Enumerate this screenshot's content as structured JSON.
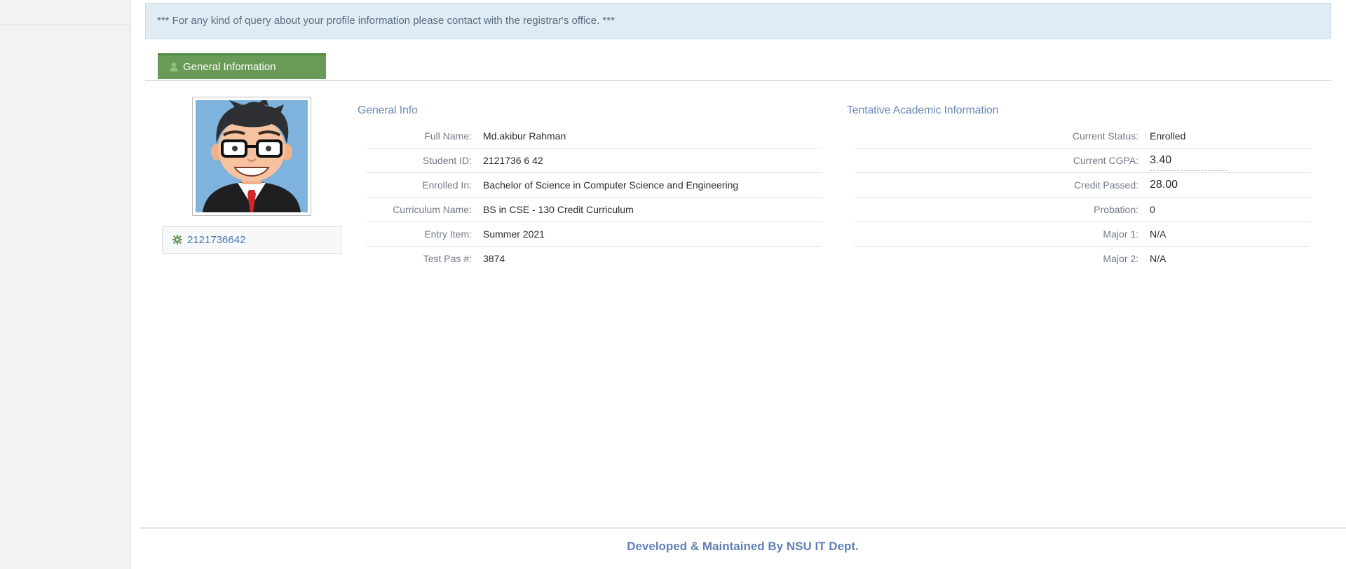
{
  "notice": {
    "text": "*** For any kind of query about your profile information please contact with the registrar's office. ***"
  },
  "tabs": [
    {
      "label": "General Information",
      "icon": "user-icon",
      "active": true
    }
  ],
  "profile": {
    "student_id_link": "2121736642",
    "id_icon": "gear-icon"
  },
  "general_info": {
    "title": "General Info",
    "rows": [
      {
        "label": "Full Name:",
        "value": " Md.akibur Rahman"
      },
      {
        "label": "Student ID:",
        "value": "2121736 6 42"
      },
      {
        "label": "Enrolled In:",
        "value": "Bachelor of Science in Computer Science and Engineering"
      },
      {
        "label": "Curriculum Name:",
        "value": "BS in CSE - 130 Credit Curriculum"
      },
      {
        "label": "Entry Item:",
        "value": "Summer 2021"
      },
      {
        "label": "Test Pas #:",
        "value": "3874"
      }
    ]
  },
  "academic_info": {
    "title": "Tentative Academic Information",
    "rows": [
      {
        "label": "Current Status:",
        "value": "Enrolled"
      },
      {
        "label": "Current CGPA:",
        "value": "3.40"
      },
      {
        "label": "Credit Passed:",
        "value": "28.00"
      },
      {
        "label": "Probation:",
        "value": "0"
      },
      {
        "label": "Major 1:",
        "value": "N/A"
      },
      {
        "label": "Major 2:",
        "value": "N/A"
      }
    ]
  },
  "footer": {
    "text": "Developed & Maintained By NSU IT Dept."
  },
  "colors": {
    "tab_bg": "#6a9a58",
    "notice_bg": "#dfebf5",
    "accent_blue": "#6381b8"
  }
}
